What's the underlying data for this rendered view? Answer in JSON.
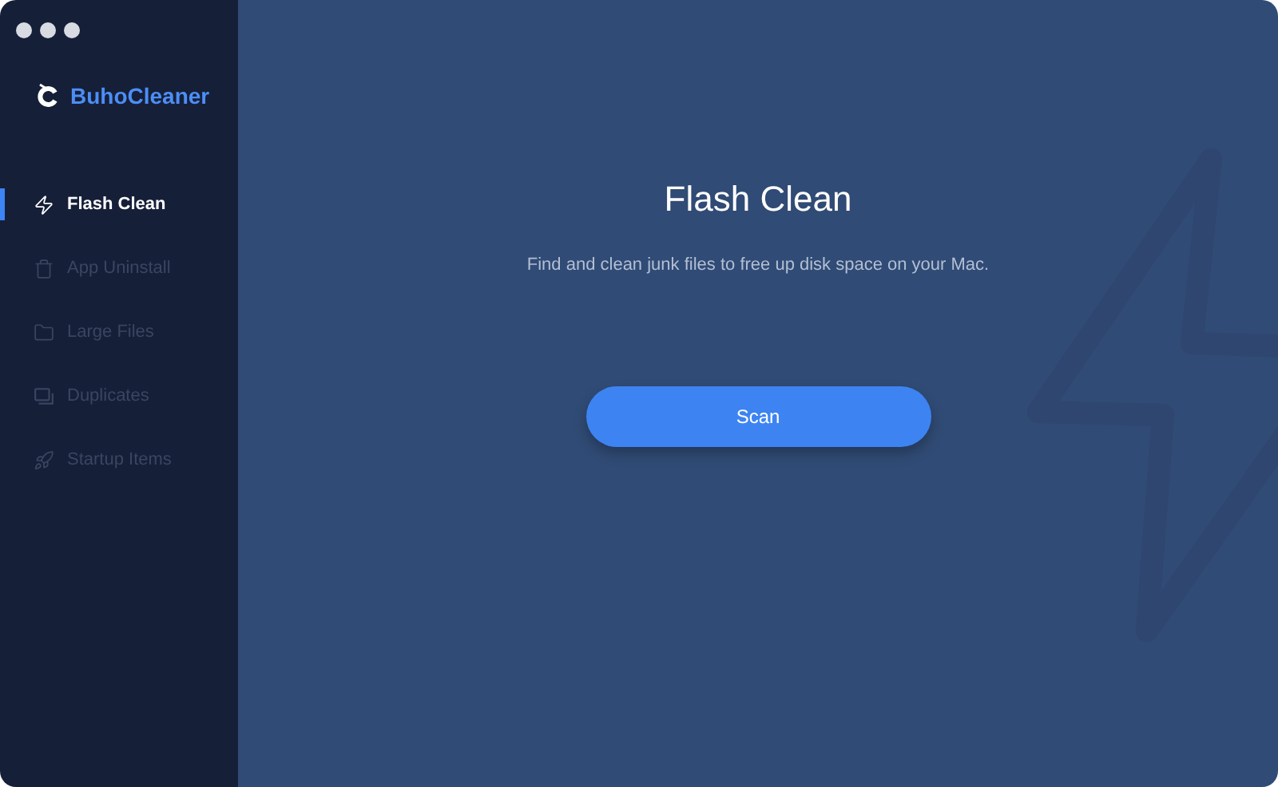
{
  "app": {
    "name": "BuhoCleaner"
  },
  "sidebar": {
    "items": [
      {
        "label": "Flash Clean",
        "kind": "flash",
        "selected": true
      },
      {
        "label": "App Uninstall",
        "kind": "trash",
        "selected": false
      },
      {
        "label": "Large Files",
        "kind": "folder",
        "selected": false
      },
      {
        "label": "Duplicates",
        "kind": "duplicates",
        "selected": false
      },
      {
        "label": "Startup Items",
        "kind": "rocket",
        "selected": false
      }
    ]
  },
  "main": {
    "title": "Flash Clean",
    "subtitle": "Find and clean junk files to free up disk space on your Mac.",
    "button": "Scan"
  }
}
